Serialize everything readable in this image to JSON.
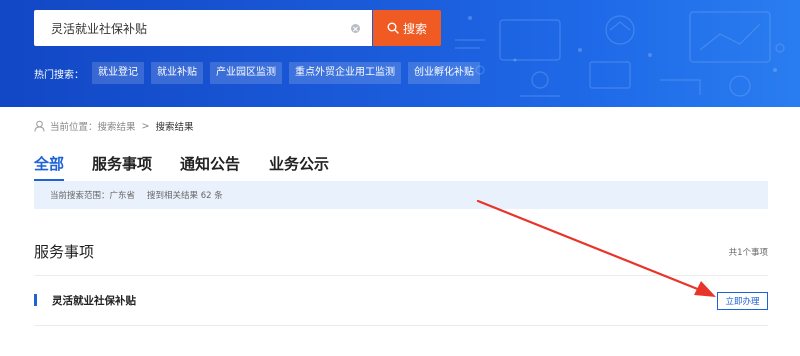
{
  "search": {
    "value": "灵活就业社保补贴",
    "button_label": "搜索",
    "icon": "search-icon",
    "clear_icon": "clear-icon"
  },
  "hot_search": {
    "label": "热门搜索：",
    "tags": [
      "就业登记",
      "就业补贴",
      "产业园区监测",
      "重点外贸企业用工监测",
      "创业孵化补贴"
    ]
  },
  "breadcrumb": {
    "icon": "user-icon",
    "prefix": "当前位置：",
    "items": [
      "搜索结果",
      "搜索结果"
    ],
    "separator": ">"
  },
  "tabs": [
    {
      "label": "全部",
      "active": true
    },
    {
      "label": "服务事项",
      "active": false
    },
    {
      "label": "通知公告",
      "active": false
    },
    {
      "label": "业务公示",
      "active": false
    }
  ],
  "scope": {
    "range_text": "当前搜索范围：广东省",
    "result_text": "搜到相关结果 62 条"
  },
  "section": {
    "title": "服务事项",
    "count_text": "共1个事项",
    "items": [
      {
        "title": "灵活就业社保补贴",
        "action_label": "立即办理"
      }
    ]
  },
  "colors": {
    "banner": "#1a5ad9",
    "accent": "#1d62d6",
    "search_button": "#f05a23",
    "scope_bg": "#e9f2fc",
    "annotation_arrow": "#e8342b"
  }
}
